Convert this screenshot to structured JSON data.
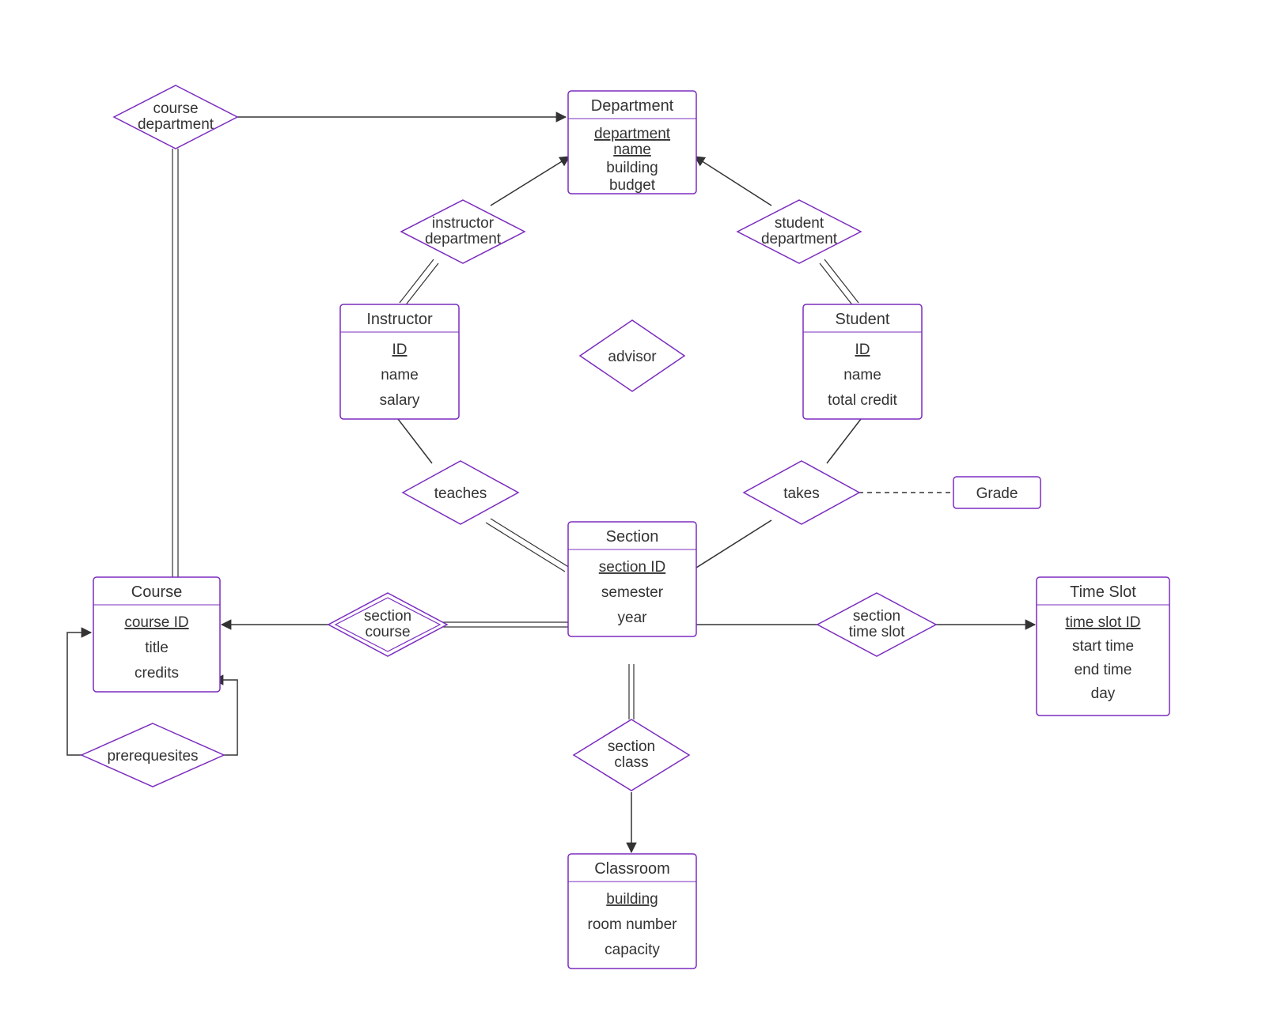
{
  "entities": {
    "department": {
      "title": "Department",
      "key": "department name",
      "a1": "building",
      "a2": "budget"
    },
    "instructor": {
      "title": "Instructor",
      "key": "ID",
      "a1": "name",
      "a2": "salary"
    },
    "student": {
      "title": "Student",
      "key": "ID",
      "a1": "name",
      "a2": "total credit"
    },
    "section": {
      "title": "Section",
      "key": "section ID",
      "a1": "semester",
      "a2": "year"
    },
    "course": {
      "title": "Course",
      "key": "course ID",
      "a1": "title",
      "a2": "credits"
    },
    "timeslot": {
      "title": "Time Slot",
      "key": "time slot ID",
      "a1": "start time",
      "a2": "end time",
      "a3": "day"
    },
    "classroom": {
      "title": "Classroom",
      "key": "building",
      "a1": "room number",
      "a2": "capacity"
    }
  },
  "relationships": {
    "course_department": {
      "l1": "course",
      "l2": "department"
    },
    "instructor_department": {
      "l1": "instructor",
      "l2": "department"
    },
    "student_department": {
      "l1": "student",
      "l2": "department"
    },
    "advisor": {
      "l1": "advisor"
    },
    "teaches": {
      "l1": "teaches"
    },
    "takes": {
      "l1": "takes"
    },
    "section_course": {
      "l1": "section",
      "l2": "course"
    },
    "section_class": {
      "l1": "section",
      "l2": "class"
    },
    "section_timeslot": {
      "l1": "section",
      "l2": "time slot"
    },
    "prerequisites": {
      "l1": "prerequesites"
    }
  },
  "attributes": {
    "grade": {
      "label": "Grade"
    }
  }
}
